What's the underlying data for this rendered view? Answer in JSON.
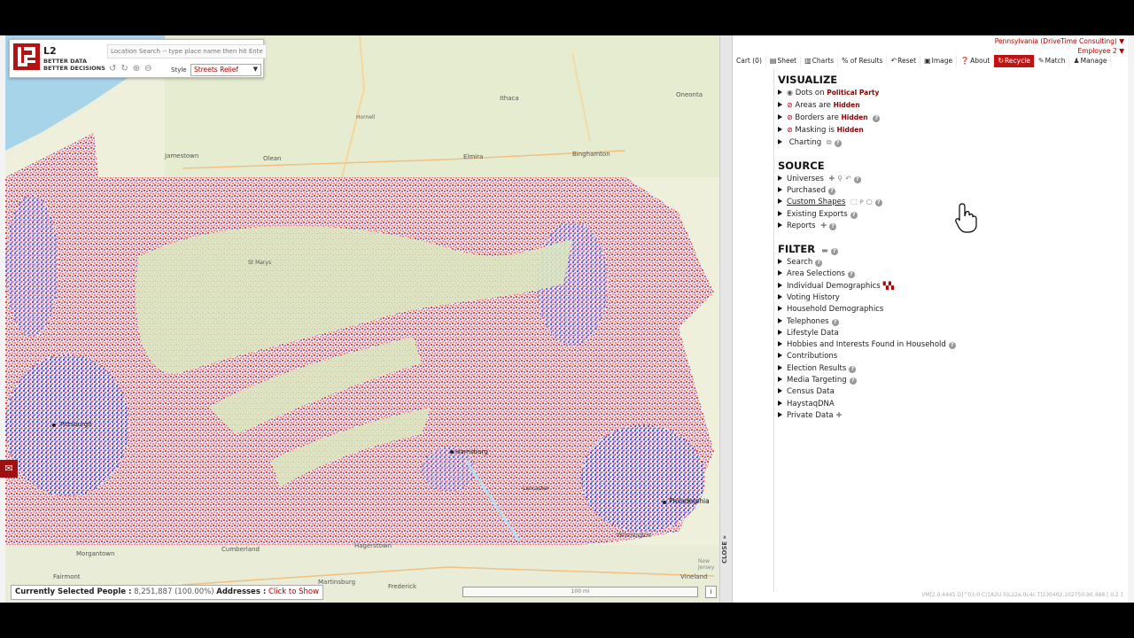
{
  "map": {
    "logo": {
      "name": "L2",
      "tagline_1": "BETTER DATA",
      "tagline_2": "BETTER DECISIONS"
    },
    "search_placeholder": "Location Search -- type place name then hit Enter",
    "style_label": "Style",
    "style_value": "Streets Relief",
    "places": {
      "ithaca": "Ithaca",
      "oneonta": "Oneonta",
      "hornell": "Hornell",
      "jamestown": "Jamestown",
      "olean": "Olean",
      "elmira": "Elmira",
      "binghamton": "Binghamton",
      "pittsburgh": "Pittsburgh",
      "harrisburg": "Harrisburg",
      "philadelphia": "Philadelphia",
      "wilmington": "Wilmington",
      "morgantown": "Morgantown",
      "cumberland": "Cumberland",
      "hagerstown": "Hagerstown",
      "martinsburg": "Martinsburg",
      "frederick": "Frederick",
      "fairmont": "Fairmont",
      "vineland": "Vineland",
      "new_jersey": "New Jersey",
      "lancaster": "Lancaster",
      "stmarys": "St Marys"
    },
    "status": {
      "label": "Currently Selected People :",
      "value": "8,251,887 (100.00%)",
      "addresses_label": "Addresses :",
      "addresses_link": "Click to Show"
    },
    "scale": "100 mi",
    "scale_btn": "i",
    "close_label": "CLOSE"
  },
  "account": {
    "project": "Pennsylvania (DriveTime Consulting)",
    "user": "Employee 2"
  },
  "toolbar": {
    "cart": "Cart (0)",
    "sheet": "Sheet",
    "charts": "Charts",
    "pct": "% of Results",
    "reset": "Reset",
    "image": "Image",
    "about": "About",
    "recycle": "Recycle",
    "match": "Match",
    "manage": "Manage"
  },
  "visualize": {
    "title": "VISUALIZE",
    "dots": "Dots",
    "dots_on": "on",
    "dots_value": "Political Party",
    "areas": "Areas",
    "areas_are": "are",
    "areas_value": "Hidden",
    "borders": "Borders",
    "borders_are": "are",
    "borders_value": "Hidden",
    "masking": "Masking",
    "masking_is": "is",
    "masking_value": "Hidden",
    "charting": "Charting"
  },
  "source": {
    "title": "SOURCE",
    "universes": "Universes",
    "purchased": "Purchased",
    "custom_shapes": "Custom Shapes",
    "existing_exports": "Existing Exports",
    "reports": "Reports"
  },
  "filter": {
    "title": "FILTER",
    "items": [
      "Search",
      "Area Selections",
      "Individual Demographics",
      "Voting History",
      "Household Demographics",
      "Telephones",
      "Lifestyle Data",
      "Hobbies and Interests Found in Household",
      "Contributions",
      "Election Results",
      "Media Targeting",
      "Census Data",
      "HaystaqDNA",
      "Private Data"
    ]
  },
  "version": "VM[2.0.4445 D]^03-0 C|1A2U 5|L22e.0c4c T|230402.102750.90.488 [ 0.2 ]"
}
